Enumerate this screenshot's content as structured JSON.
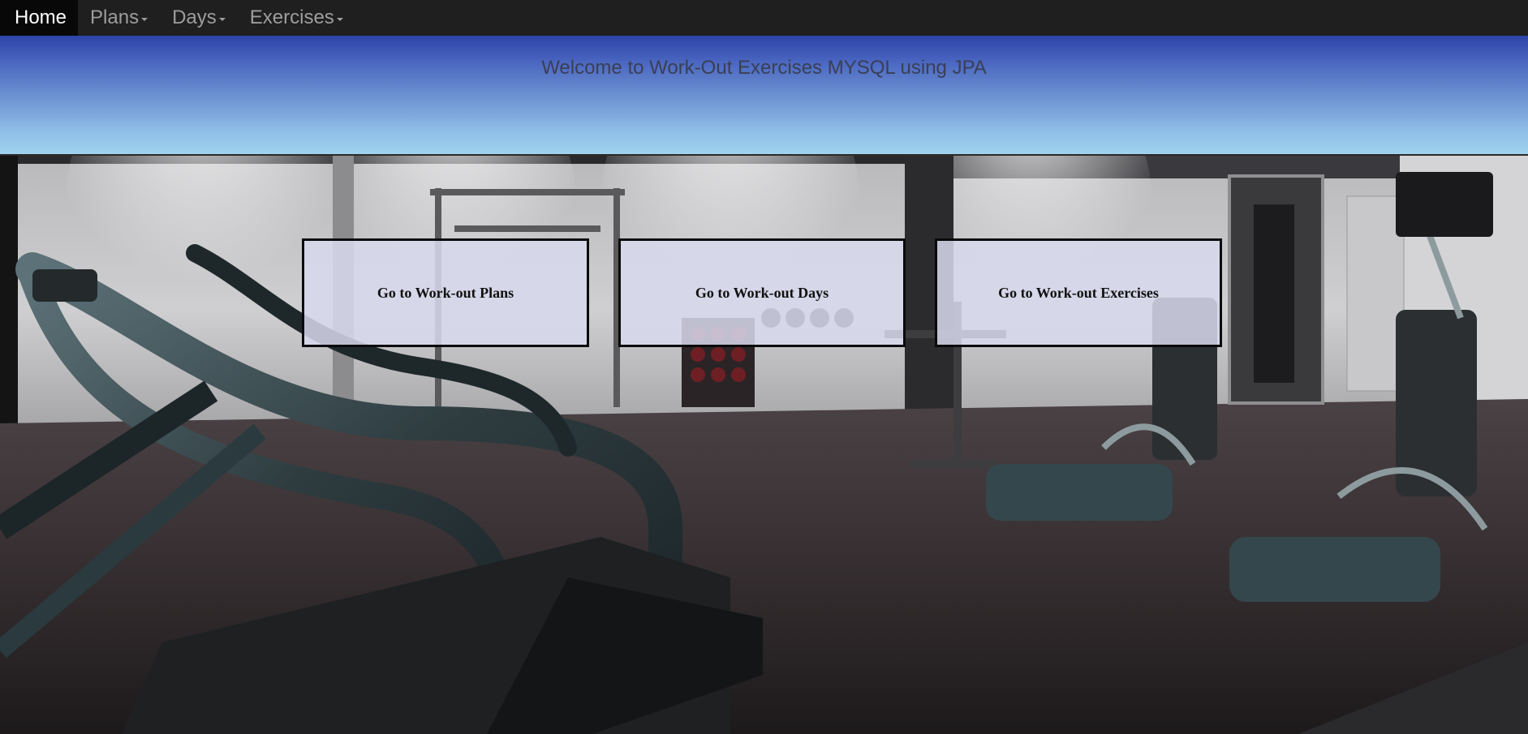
{
  "navbar": {
    "items": [
      {
        "label": "Home",
        "active": true,
        "dropdown": false
      },
      {
        "label": "Plans",
        "active": false,
        "dropdown": true
      },
      {
        "label": "Days",
        "active": false,
        "dropdown": true
      },
      {
        "label": "Exercises",
        "active": false,
        "dropdown": true
      }
    ]
  },
  "hero": {
    "title": "Welcome to Work-Out Exercises MYSQL using JPA"
  },
  "links": {
    "plans": "Go to Work-out Plans",
    "days": "Go to Work-out Days",
    "exercises": "Go to Work-out Exercises"
  },
  "background": {
    "description_icon": "gym-photo"
  }
}
